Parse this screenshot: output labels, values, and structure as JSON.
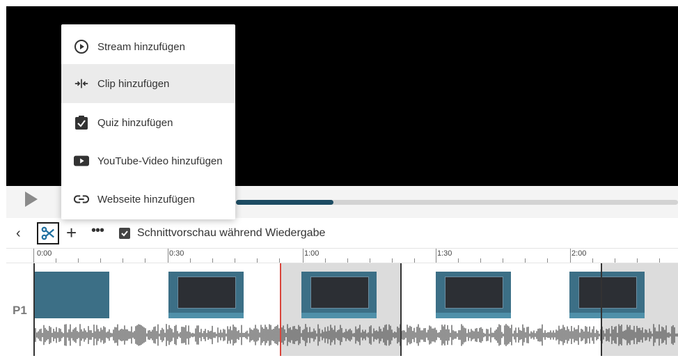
{
  "menu": {
    "items": [
      {
        "label": "Stream hinzufügen",
        "icon": "play-circle-icon"
      },
      {
        "label": "Clip hinzufügen",
        "icon": "split-clip-icon"
      },
      {
        "label": "Quiz hinzufügen",
        "icon": "quiz-clipboard-icon"
      },
      {
        "label": "YouTube-Video hinzufügen",
        "icon": "youtube-icon"
      },
      {
        "label": "Webseite hinzufügen",
        "icon": "link-icon"
      }
    ]
  },
  "player": {
    "progress": 0.22
  },
  "toolbar": {
    "back_icon": "chevron-left-icon",
    "cut_icon": "scissors-icon",
    "add_icon": "plus-icon",
    "more_icon": "more-dots-icon",
    "preview_checked": true,
    "preview_label": "Schnittvorschau während Wiedergabe"
  },
  "timeline": {
    "time_labels": [
      "0:00",
      "0:30",
      "1:00",
      "1:30",
      "2:00"
    ],
    "lane_label": "P1"
  },
  "colors": {
    "progress_fill": "#1d4c63",
    "cursor": "#d9453b",
    "thumbnail": "#3c6f86"
  }
}
